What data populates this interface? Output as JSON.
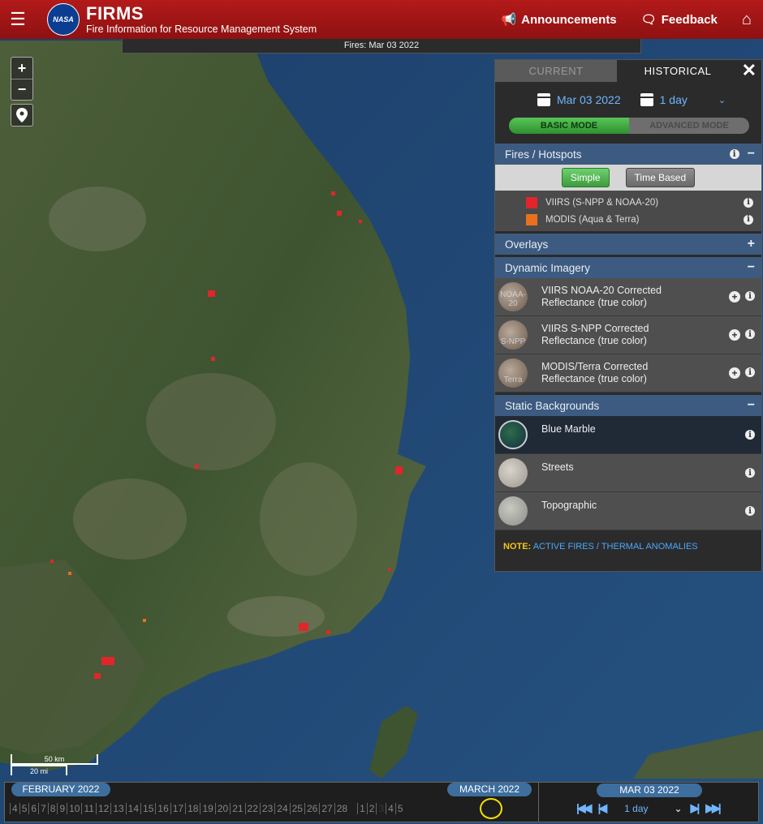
{
  "header": {
    "logo_text": "NASA",
    "title": "FIRMS",
    "subtitle": "Fire Information for Resource Management System",
    "announcements_label": "Announcements",
    "feedback_label": "Feedback"
  },
  "map": {
    "fires_label": "Fires: Mar 03 2022",
    "zoom_in": "+",
    "zoom_out": "−",
    "scale_km": "50 km",
    "scale_mi": "20 mi"
  },
  "panel": {
    "tabs": [
      {
        "label": "CURRENT",
        "active": false
      },
      {
        "label": "HISTORICAL",
        "active": true
      }
    ],
    "close_label": "✕",
    "date": "Mar 03 2022",
    "range": "1 day",
    "modes": {
      "basic": "BASIC MODE",
      "advanced": "ADVANCED MODE"
    },
    "fires_section": {
      "title": "Fires / Hotspots",
      "simple_label": "Simple",
      "time_based_label": "Time Based",
      "legend": [
        {
          "label": "VIIRS (S-NPP & NOAA-20)",
          "color": "#e0262b"
        },
        {
          "label": "MODIS (Aqua & Terra)",
          "color": "#e8701f"
        }
      ]
    },
    "overlays_title": "Overlays",
    "dynamic_title": "Dynamic Imagery",
    "dynamic_layers": [
      {
        "line1": "VIIRS NOAA-20 Corrected",
        "line2": "Reflectance (true color)",
        "thumb": "NOAA-20"
      },
      {
        "line1": "VIIRS S-NPP Corrected",
        "line2": "Reflectance (true color)",
        "thumb": "S-NPP"
      },
      {
        "line1": "MODIS/Terra Corrected",
        "line2": "Reflectance (true color)",
        "thumb": "Terra"
      }
    ],
    "static_title": "Static Backgrounds",
    "static_layers": [
      {
        "label": "Blue Marble",
        "selected": true
      },
      {
        "label": "Streets",
        "selected": false
      },
      {
        "label": "Topographic",
        "selected": false
      }
    ],
    "note_prefix": "NOTE:",
    "note_text": "ACTIVE FIRES / THERMAL ANOMALIES"
  },
  "timeline": {
    "month_left": "FEBRUARY 2022",
    "month_right": "MARCH 2022",
    "days": [
      "4",
      "5",
      "6",
      "7",
      "8",
      "9",
      "10",
      "11",
      "12",
      "13",
      "14",
      "15",
      "16",
      "17",
      "18",
      "19",
      "20",
      "21",
      "22",
      "23",
      "24",
      "25",
      "26",
      "27",
      "28",
      "1",
      "2",
      "3",
      "4",
      "5"
    ],
    "current_day": "3",
    "selected_date": "MAR 03 2022",
    "range": "1 day"
  }
}
